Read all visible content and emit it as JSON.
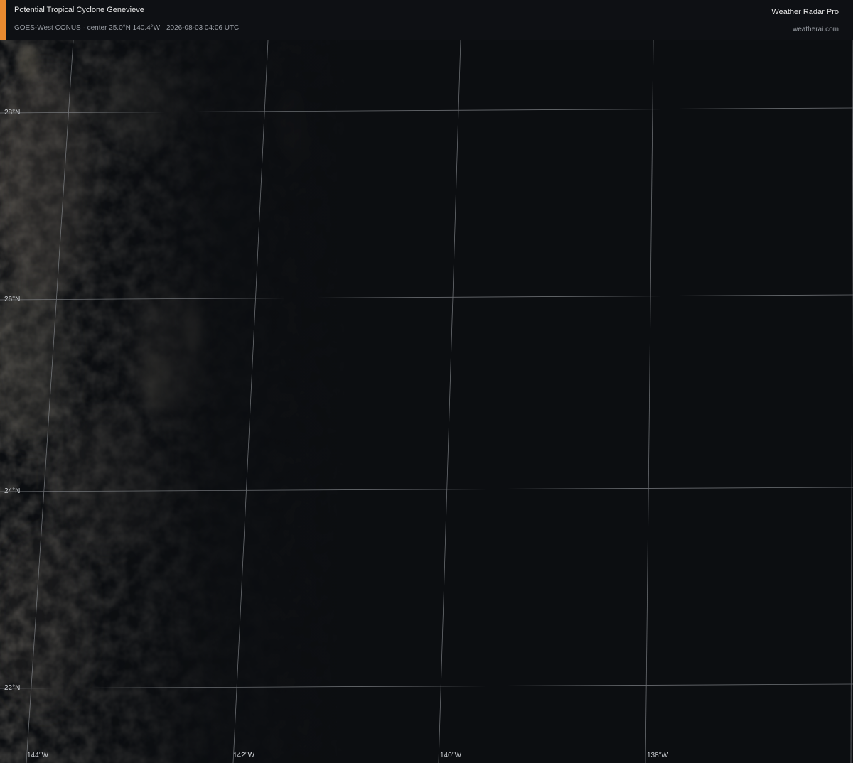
{
  "header": {
    "title": "Potential Tropical Cyclone Genevieve",
    "subtitle": "GOES-West CONUS · center 25.0°N 140.4°W · 2026-08-03 04:06 UTC",
    "brand": "Weather Radar Pro",
    "site": "weatherai.com",
    "accent_color": "#e98a2f"
  },
  "map": {
    "type": "satellite-visible",
    "latitude_labels": [
      "28°N",
      "26°N",
      "24°N",
      "22°N"
    ],
    "longitude_labels": [
      "144°W",
      "142°W",
      "140°W",
      "138°W"
    ],
    "gridline_color": "#8a8d92"
  }
}
